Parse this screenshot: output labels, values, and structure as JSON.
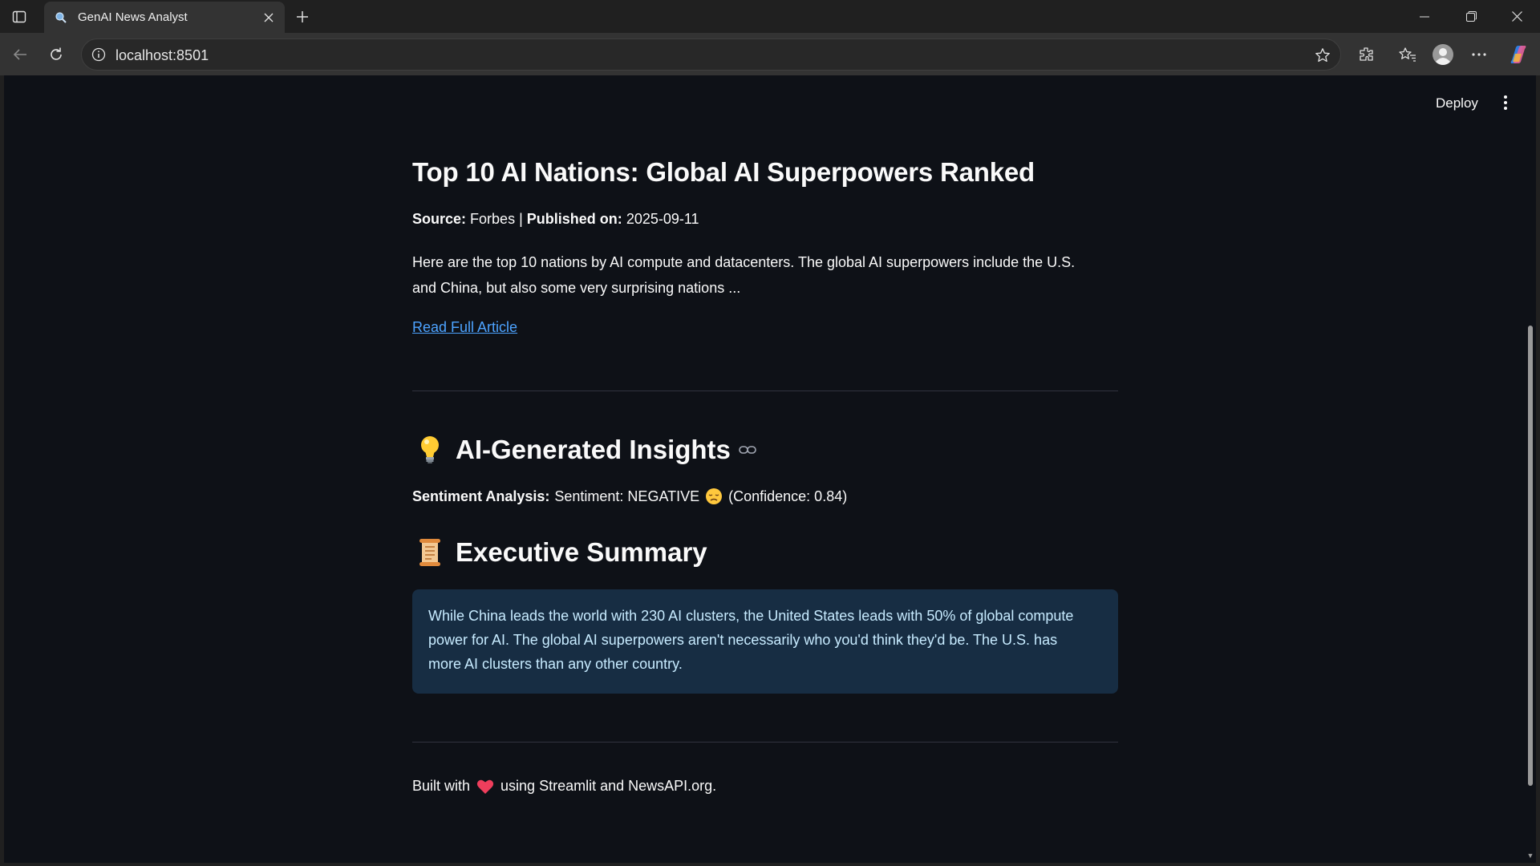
{
  "browser": {
    "tab_title": "GenAI News Analyst",
    "url": "localhost:8501"
  },
  "app_header": {
    "deploy_label": "Deploy"
  },
  "article": {
    "title": "Top 10 AI Nations: Global AI Superpowers Ranked",
    "source_label": "Source:",
    "source": "Forbes",
    "separator": "|",
    "published_label": "Published on:",
    "published_date": "2025-09-11",
    "description_line1": "Here are the top 10 nations by AI compute and datacenters. The global AI superpowers include the U.S.",
    "description_line2": "and China, but also some very surprising nations ...",
    "link_text": "Read Full Article"
  },
  "insights": {
    "heading_emoji": "💡",
    "heading": "AI-Generated Insights",
    "sentiment_label": "Sentiment Analysis:",
    "sentiment_text": "Sentiment: NEGATIVE",
    "confidence_text": "(Confidence: 0.84)"
  },
  "summary": {
    "heading_emoji": "📜",
    "heading": "Executive Summary",
    "line1": "While China leads the world with 230 AI clusters, the United States leads with 50% of global compute",
    "line2": "power for AI. The global AI superpowers aren't necessarily who you'd think they'd be. The U.S. has",
    "line3": "more AI clusters than any other country."
  },
  "footer": {
    "prefix": "Built with",
    "suffix": "using Streamlit and NewsAPI.org."
  },
  "colors": {
    "page_bg": "#0e1117",
    "link": "#4da3ff",
    "info_box_bg": "#172d43",
    "info_box_text": "#c7ebff"
  }
}
